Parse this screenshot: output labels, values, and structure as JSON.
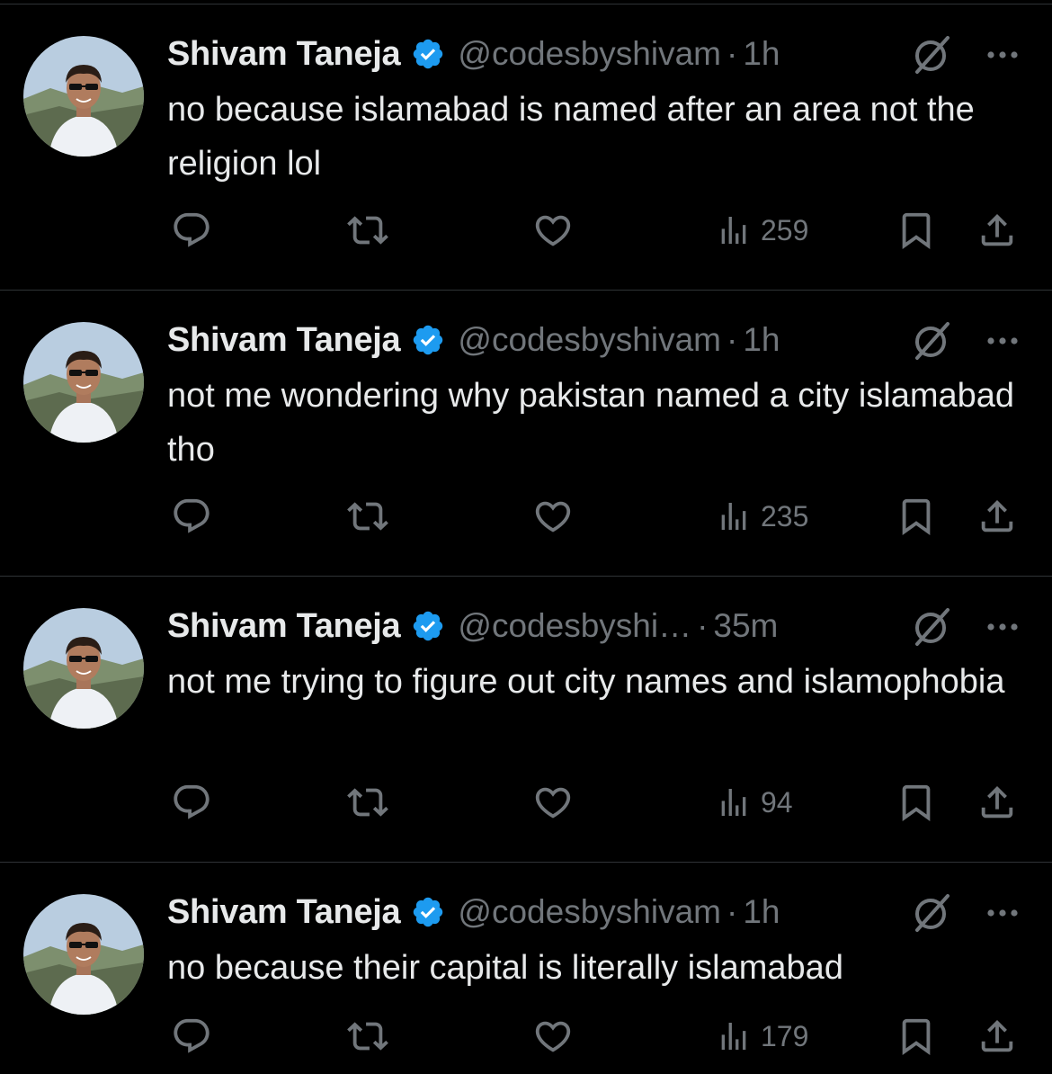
{
  "tweets": [
    {
      "name": "Shivam Taneja",
      "handle": "@codesbyshivam",
      "time": "1h",
      "text": "no because islamabad is named after an area not the religion lol",
      "views": "259"
    },
    {
      "name": "Shivam Taneja",
      "handle": "@codesbyshivam",
      "time": "1h",
      "text": "not me wondering why pakistan named a city islamabad tho",
      "views": "235"
    },
    {
      "name": "Shivam Taneja",
      "handle": "@codesbyshi…",
      "time": "35m",
      "text": "not me trying to figure out city names and islamophobia",
      "views": "94"
    },
    {
      "name": "Shivam Taneja",
      "handle": "@codesbyshivam",
      "time": "1h",
      "text": "no because their capital is literally islamabad",
      "views": "179"
    }
  ],
  "separator": "·",
  "icons": {
    "verified": "verified-badge-icon",
    "grok": "grok-icon",
    "more": "more-icon",
    "reply": "reply-icon",
    "retweet": "retweet-icon",
    "like": "like-icon",
    "views": "views-icon",
    "bookmark": "bookmark-icon",
    "share": "share-icon"
  },
  "colors": {
    "background": "#000000",
    "text": "#e7e9ea",
    "muted": "#71767b",
    "verified": "#1d9bf0",
    "divider": "#2f3336"
  }
}
